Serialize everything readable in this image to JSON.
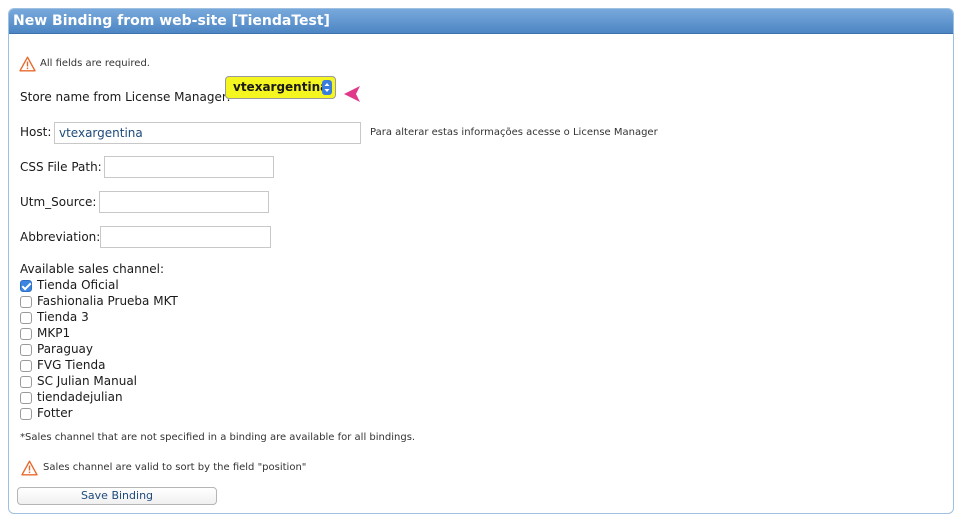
{
  "window": {
    "title": "New Binding from web-site [TiendaTest]"
  },
  "form": {
    "required_notice": "All fields are required.",
    "store_label": "Store name from License Manager:",
    "store_selected": "vtexargentina",
    "host_label": "Host:",
    "host_value": "vtexargentina",
    "host_note": "Para alterar estas informações acesse o License Manager",
    "css_label": "CSS File Path:",
    "css_value": "",
    "utm_label": "Utm_Source:",
    "utm_value": "",
    "abbr_label": "Abbreviation:",
    "abbr_value": "",
    "channels_label": "Available sales channel:",
    "channels": [
      {
        "label": "Tienda Oficial",
        "checked": true
      },
      {
        "label": "Fashionalia Prueba MKT",
        "checked": false
      },
      {
        "label": "Tienda 3",
        "checked": false
      },
      {
        "label": "MKP1",
        "checked": false
      },
      {
        "label": "Paraguay",
        "checked": false
      },
      {
        "label": "FVG Tienda",
        "checked": false
      },
      {
        "label": "SC Julian Manual",
        "checked": false
      },
      {
        "label": "tiendadejulian",
        "checked": false
      },
      {
        "label": "Fotter",
        "checked": false
      }
    ],
    "channels_note": "*Sales channel that are not specified in a binding are available for all bindings.",
    "sort_warning": "Sales channel are valid to sort by the field \"position\"",
    "save_label": "Save Binding"
  },
  "icons": {
    "warning": "warning-triangle-icon",
    "pointer": "pink-pointer-arrow-icon",
    "select_arrows": "select-updown-icon"
  },
  "colors": {
    "titlebar": "#5b92cf",
    "select_highlight": "#f5f520",
    "pointer": "#e0398a",
    "warning": "#e8692c",
    "checkbox_checked": "#3b86e0"
  }
}
